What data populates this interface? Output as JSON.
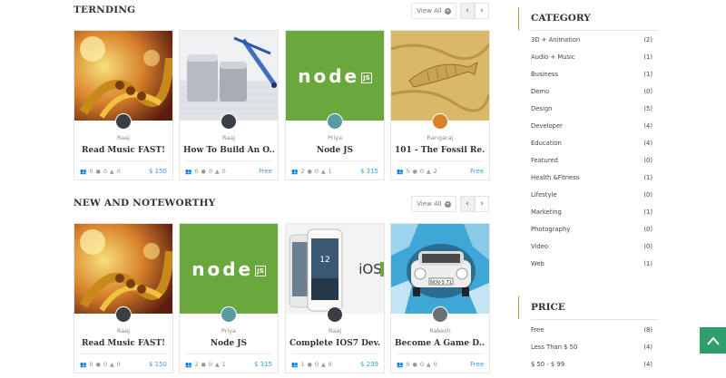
{
  "trending": {
    "title": "TERNDING",
    "view_all": "View All",
    "cards": [
      {
        "author": "Raaj",
        "title": "Read Music FAST!",
        "students": "0",
        "comments": "0",
        "likes": "0",
        "price": "$ 150"
      },
      {
        "author": "Raaj",
        "title": "How To Build An O...",
        "students": "0",
        "comments": "0",
        "likes": "0",
        "price": "Free"
      },
      {
        "author": "Priya",
        "title": "Node JS",
        "students": "2",
        "comments": "0",
        "likes": "1",
        "price": "$ 315"
      },
      {
        "author": "Rangaraj",
        "title": "101 - The Fossil Re...",
        "students": "5",
        "comments": "0",
        "likes": "2",
        "price": "Free"
      }
    ]
  },
  "noteworthy": {
    "title": "NEW AND NOTEWORTHY",
    "view_all": "View All",
    "cards": [
      {
        "author": "Raaj",
        "title": "Read Music FAST!",
        "students": "0",
        "comments": "0",
        "likes": "0",
        "price": "$ 150"
      },
      {
        "author": "Priya",
        "title": "Node JS",
        "students": "2",
        "comments": "0",
        "likes": "1",
        "price": "$ 315"
      },
      {
        "author": "Raaj",
        "title": "Complete IOS7 Dev...",
        "students": "1",
        "comments": "0",
        "likes": "0",
        "price": "$ 239"
      },
      {
        "author": "Rakesh",
        "title": "Become A Game D...",
        "students": "0",
        "comments": "0",
        "likes": "0",
        "price": "Free"
      }
    ]
  },
  "thumb_text": {
    "node": "node",
    "js": "JS",
    "ios": "iOS",
    "clock": "12",
    "plate": "NOV-5 71"
  },
  "sidebar": {
    "category_title": "CATEGORY",
    "categories": [
      {
        "name": "3D + Animation",
        "count": "(2)"
      },
      {
        "name": "Audio + Music",
        "count": "(1)"
      },
      {
        "name": "Business",
        "count": "(1)"
      },
      {
        "name": "Demo",
        "count": "(0)"
      },
      {
        "name": "Design",
        "count": "(5)"
      },
      {
        "name": "Developer",
        "count": "(4)"
      },
      {
        "name": "Education",
        "count": "(4)"
      },
      {
        "name": "Featured",
        "count": "(0)"
      },
      {
        "name": "Health &Fitness",
        "count": "(1)"
      },
      {
        "name": "Lifestyle",
        "count": "(0)"
      },
      {
        "name": "Marketing",
        "count": "(1)"
      },
      {
        "name": "Photography",
        "count": "(0)"
      },
      {
        "name": "Video",
        "count": "(0)"
      },
      {
        "name": "Web",
        "count": "(1)"
      }
    ],
    "price_title": "PRICE",
    "prices": [
      {
        "name": "Free",
        "count": "(8)"
      },
      {
        "name": "Less Than $ 50",
        "count": "(4)"
      },
      {
        "name": "$ 50 - $ 99",
        "count": "(4)"
      }
    ]
  },
  "colors": {
    "accent": "#7cb342",
    "price": "#3b9ddf",
    "back_to_top": "#2e9e6c",
    "node_green": "#6aa83d"
  },
  "icons": {
    "students": "users-icon",
    "comments": "comment-icon",
    "likes": "thumbs-up-icon",
    "prev": "chevron-left-icon",
    "next": "chevron-right-icon",
    "back_to_top": "arrow-up-icon"
  }
}
